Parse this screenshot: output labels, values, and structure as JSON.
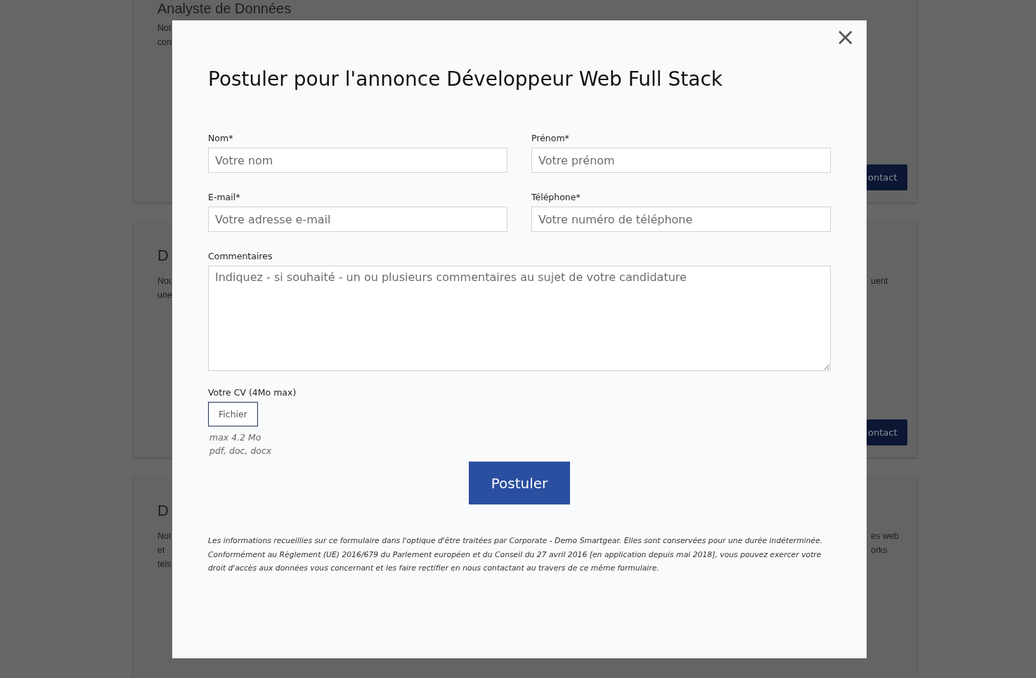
{
  "background_cards": [
    {
      "title": "Analyste de Données",
      "left_lines": [
        "Not",
        "con"
      ],
      "button": "ontact"
    },
    {
      "title": "D",
      "left_lines": [
        "Nou",
        "une"
      ],
      "right_lines": [
        "uent"
      ],
      "button": "ontact"
    },
    {
      "title": "D",
      "left_lines": [
        "Not",
        "et",
        "tels"
      ],
      "right_lines": [
        "es web",
        "orks"
      ]
    }
  ],
  "modal": {
    "close": "×",
    "title": "Postuler pour l'annonce Développeur Web Full Stack",
    "fields": [
      {
        "label": "Nom*",
        "placeholder": "Votre nom"
      },
      {
        "label": "Prénom*",
        "placeholder": "Votre prénom"
      },
      {
        "label": "E-mail*",
        "placeholder": "Votre adresse e-mail"
      },
      {
        "label": "Téléphone*",
        "placeholder": "Votre numéro de téléphone"
      }
    ],
    "comments": {
      "label": "Commentaires",
      "placeholder": "Indiquez - si souhaité - un ou plusieurs commentaires au sujet de votre candidature"
    },
    "cv": {
      "label": "Votre CV (4Mo max)",
      "button": "Fichier",
      "hints": [
        "max 4.2 Mo",
        "pdf, doc, docx"
      ]
    },
    "submit": "Postuler",
    "legal": "Les informations recueillies sur ce formulaire dans l'optique d'être traitées par Corporate - Demo Smartgear. Elles sont conservées pour une durée indéterminée. Conformément au Règlement (UE) 2016/679 du Parlement européen et du Conseil du 27 avril 2016 [en application depuis mai 2018], vous pouvez exercer votre droit d'accès aux données vous concernant et les faire rectifier en nous contactant au travers de ce même formulaire."
  }
}
